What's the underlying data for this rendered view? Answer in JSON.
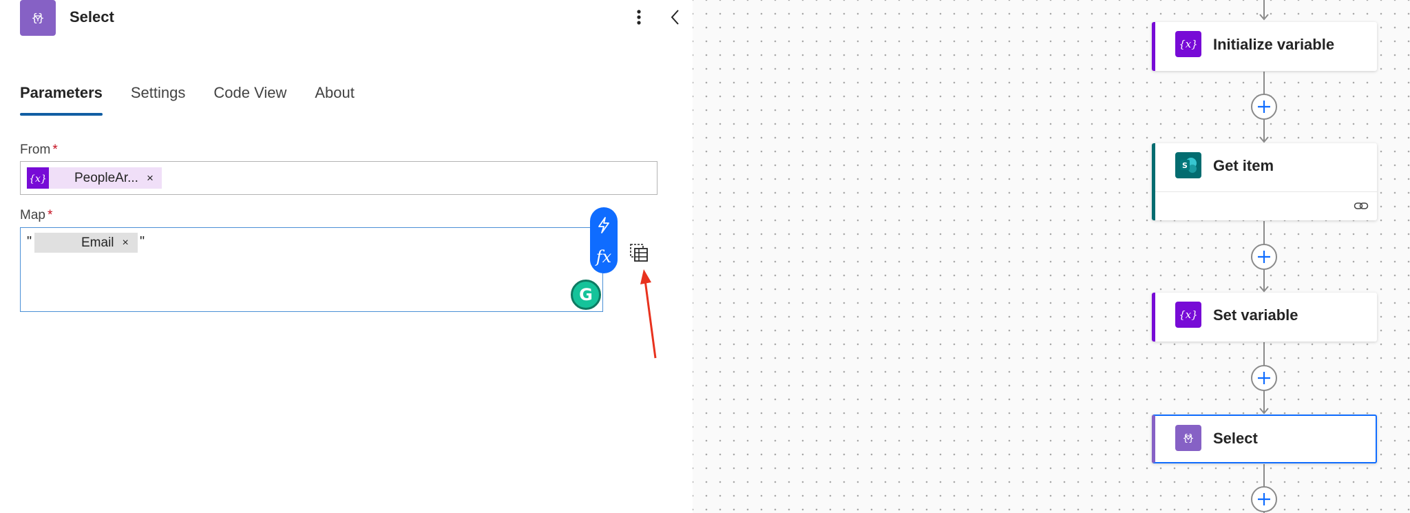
{
  "panel": {
    "title": "Select",
    "tabs": [
      "Parameters",
      "Settings",
      "Code View",
      "About"
    ],
    "active_tab": "Parameters",
    "from": {
      "label": "From",
      "required_mark": "*",
      "token_label": "PeopleAr...",
      "token_remove": "×"
    },
    "map": {
      "label": "Map",
      "required_mark": "*",
      "open_quote": "\"",
      "close_quote": "\"",
      "token_label": "Email",
      "token_remove": "×"
    },
    "grammarly_glyph": "G",
    "fx_label": "fx"
  },
  "flow": {
    "cards": [
      {
        "title": "Initialize variable",
        "icon": "variable-icon",
        "color": "#770bd6"
      },
      {
        "title": "Get item",
        "icon": "sharepoint-icon",
        "color": "#036c70"
      },
      {
        "title": "Set variable",
        "icon": "variable-icon",
        "color": "#770bd6"
      },
      {
        "title": "Select",
        "icon": "select-data-icon",
        "color": "#8661c5"
      }
    ]
  },
  "colors": {
    "accent": "#0f6cff",
    "tab_underline": "#115ea3",
    "arrow": "#e8321e"
  }
}
